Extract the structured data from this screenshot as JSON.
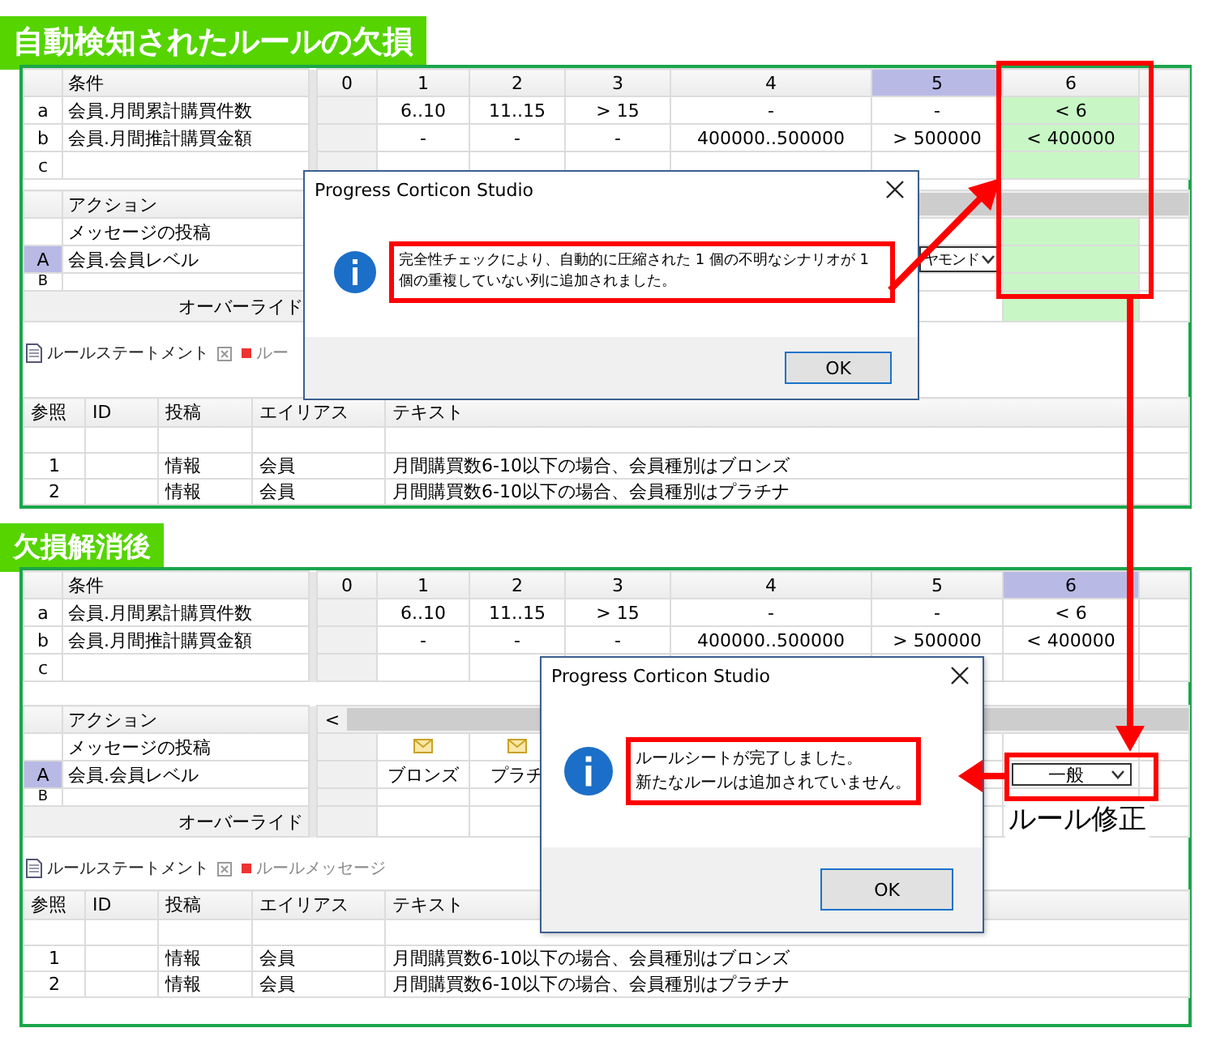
{
  "panels": [
    {
      "heading": "自動検知されたルールの欠損",
      "condition_header": "条件",
      "columns": [
        {
          "label": "0",
          "selected": false,
          "added": false
        },
        {
          "label": "1",
          "selected": false,
          "added": false
        },
        {
          "label": "2",
          "selected": false,
          "added": false
        },
        {
          "label": "3",
          "selected": false,
          "added": false
        },
        {
          "label": "4",
          "selected": false,
          "added": false
        },
        {
          "label": "5",
          "selected": true,
          "added": false
        },
        {
          "label": "6",
          "selected": false,
          "added": true
        }
      ],
      "conditions": [
        {
          "letter": "a",
          "name": "会員.月間累計購買件数",
          "selected": false,
          "cells": [
            "",
            "6..10",
            "11..15",
            "> 15",
            "-",
            "-",
            "< 6"
          ]
        },
        {
          "letter": "b",
          "name": "会員.月間推計購買金額",
          "selected": false,
          "cells": [
            "",
            "-",
            "-",
            "-",
            "400000..500000",
            "> 500000",
            "< 400000"
          ]
        },
        {
          "letter": "c",
          "selected": false,
          "cells": [
            "",
            "",
            "",
            "",
            "",
            "",
            ""
          ]
        }
      ],
      "action_header": "アクション",
      "actions": [
        {
          "name": "メッセージの投稿",
          "selected": false,
          "cells": [
            "",
            "",
            "",
            "",
            "",
            "",
            ""
          ]
        },
        {
          "letter": "A",
          "name": "会員.会員レベル",
          "selected": true,
          "cells": [
            "",
            "",
            "",
            "",
            "",
            {
              "kind": "dropdown",
              "value": "ヤモンド"
            },
            ""
          ]
        },
        {
          "letter": "B",
          "selected": false,
          "cells": [
            "",
            "",
            "",
            "",
            "",
            "",
            ""
          ]
        }
      ],
      "override_label": "オーバーライド",
      "tabs": [
        {
          "label": "ルールステートメント",
          "selected": true
        },
        {
          "label": "ルー",
          "selected": false
        }
      ],
      "statement_columns": [
        "参照",
        "ID",
        "投稿",
        "エイリアス",
        "テキスト"
      ],
      "statement_rows": [
        [
          "1",
          "",
          "情報",
          "会員",
          "月間購買数6-10以下の場合、会員種別はブロンズ"
        ],
        [
          "2",
          "",
          "情報",
          "会員",
          "月間購買数6-10以下の場合、会員種別はプラチナ"
        ]
      ],
      "dialog": {
        "title": "Progress Corticon Studio",
        "message_lines": [
          "完全性チェックにより、自動的に圧縮された 1 個の不明なシナリオが 1 個の重複していない列に追加されました。"
        ],
        "button": "OK"
      }
    },
    {
      "heading": "欠損解消後",
      "condition_header": "条件",
      "columns": [
        {
          "label": "0",
          "selected": false,
          "added": false
        },
        {
          "label": "1",
          "selected": false,
          "added": false
        },
        {
          "label": "2",
          "selected": false,
          "added": false
        },
        {
          "label": "3",
          "selected": false,
          "added": false
        },
        {
          "label": "4",
          "selected": false,
          "added": false
        },
        {
          "label": "5",
          "selected": false,
          "added": false
        },
        {
          "label": "6",
          "selected": true,
          "added": false
        }
      ],
      "conditions": [
        {
          "letter": "a",
          "name": "会員.月間累計購買件数",
          "selected": false,
          "cells": [
            "",
            "6..10",
            "11..15",
            "> 15",
            "-",
            "-",
            "< 6"
          ]
        },
        {
          "letter": "b",
          "name": "会員.月間推計購買金額",
          "selected": false,
          "cells": [
            "",
            "-",
            "-",
            "-",
            "400000..500000",
            "> 500000",
            "< 400000"
          ]
        },
        {
          "letter": "c",
          "selected": false,
          "cells": [
            "",
            "",
            "",
            "",
            "",
            "",
            ""
          ]
        }
      ],
      "action_header": "アクション",
      "scroll_left": "<",
      "actions": [
        {
          "name": "メッセージの投稿",
          "selected": false,
          "cells": [
            "",
            {
              "kind": "message-icon"
            },
            {
              "kind": "message-icon"
            },
            "",
            "",
            "",
            ""
          ]
        },
        {
          "letter": "A",
          "name": "会員.会員レベル",
          "selected": true,
          "cells": [
            "",
            "ブロンズ",
            "プラチ",
            "",
            "",
            "",
            {
              "kind": "dropdown",
              "value": "一般"
            }
          ]
        },
        {
          "letter": "B",
          "selected": false,
          "cells": [
            "",
            "",
            "",
            "",
            "",
            "",
            ""
          ]
        }
      ],
      "override_label": "オーバーライド",
      "note": "ルール修正",
      "tabs": [
        {
          "label": "ルールステートメント",
          "selected": true
        },
        {
          "label": "ルールメッセージ",
          "selected": false
        }
      ],
      "statement_columns": [
        "参照",
        "ID",
        "投稿",
        "エイリアス",
        "テキスト"
      ],
      "statement_rows": [
        [
          "1",
          "",
          "情報",
          "会員",
          "月間購買数6-10以下の場合、会員種別はブロンズ"
        ],
        [
          "2",
          "",
          "情報",
          "会員",
          "月間購買数6-10以下の場合、会員種別はプラチナ"
        ]
      ],
      "dialog": {
        "title": "Progress Corticon Studio",
        "message_lines": [
          "ルールシートが完了しました。",
          "新たなルールは追加されていません。"
        ],
        "button": "OK"
      }
    }
  ]
}
